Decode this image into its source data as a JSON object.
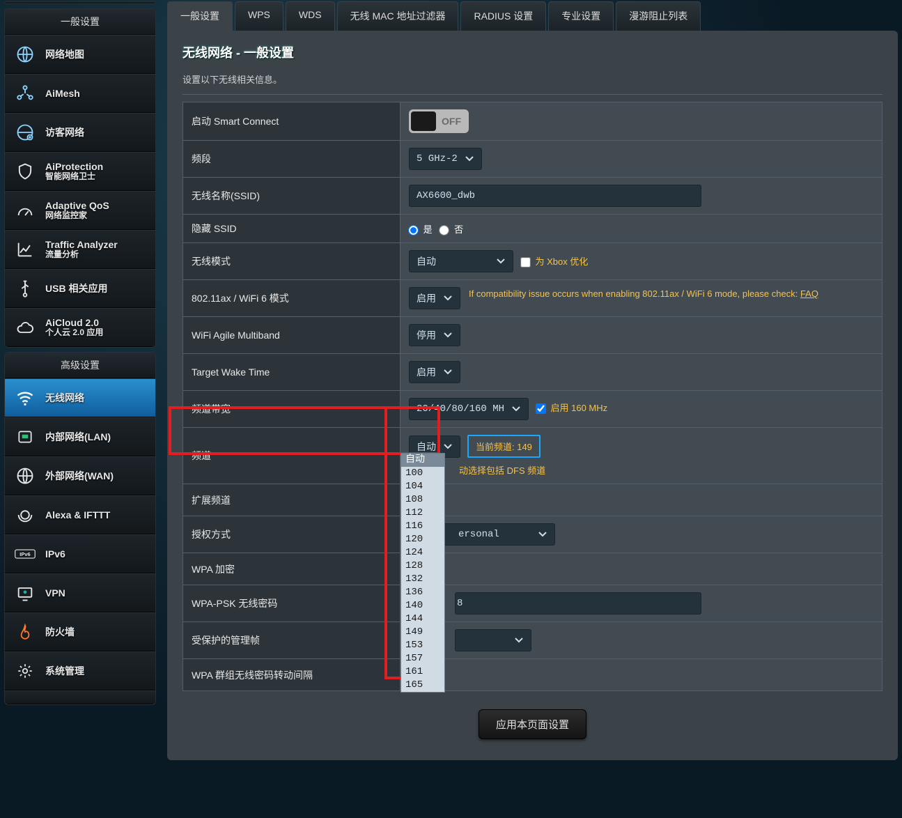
{
  "sidebar": {
    "section_general": "一般设置",
    "section_advanced": "高级设置",
    "general_items": [
      {
        "label": "网络地图"
      },
      {
        "label": "AiMesh"
      },
      {
        "label": "访客网络"
      },
      {
        "label": "AiProtection",
        "sub": "智能网络卫士"
      },
      {
        "label": "Adaptive QoS",
        "sub": "网络监控家"
      },
      {
        "label": "Traffic Analyzer",
        "sub": "流量分析"
      },
      {
        "label": "USB 相关应用"
      },
      {
        "label": "AiCloud 2.0",
        "sub": "个人云 2.0 应用"
      }
    ],
    "advanced_items": [
      {
        "label": "无线网络",
        "active": true
      },
      {
        "label": "内部网络(LAN)"
      },
      {
        "label": "外部网络(WAN)"
      },
      {
        "label": "Alexa & IFTTT"
      },
      {
        "label": "IPv6"
      },
      {
        "label": "VPN"
      },
      {
        "label": "防火墙"
      },
      {
        "label": "系统管理"
      }
    ]
  },
  "tabs": [
    "一般设置",
    "WPS",
    "WDS",
    "无线 MAC 地址过滤器",
    "RADIUS 设置",
    "专业设置",
    "漫游阻止列表"
  ],
  "active_tab": 0,
  "page": {
    "title": "无线网络 - 一般设置",
    "desc": "设置以下无线相关信息。"
  },
  "form": {
    "smart_connect": {
      "label": "启动 Smart Connect",
      "state": "OFF"
    },
    "band": {
      "label": "频段",
      "value": "5 GHz-2"
    },
    "ssid": {
      "label": "无线名称(SSID)",
      "value": "AX6600_dwb"
    },
    "hide_ssid": {
      "label": "隐藏 SSID",
      "yes": "是",
      "no": "否",
      "selected": "yes"
    },
    "mode": {
      "label": "无线模式",
      "value": "自动",
      "xbox_label": "为 Xbox 优化"
    },
    "ax": {
      "label": "802.11ax / WiFi 6 模式",
      "value": "启用",
      "note": "If compatibility issue occurs when enabling 802.11ax / WiFi 6 mode, please check: ",
      "faq": "FAQ"
    },
    "agile": {
      "label": "WiFi Agile Multiband",
      "value": "停用"
    },
    "twt": {
      "label": "Target Wake Time",
      "value": "启用"
    },
    "bw": {
      "label": "频道带宽",
      "value": "20/40/80/160 MH",
      "check_label": "启用 160 MHz"
    },
    "channel": {
      "label": "频道",
      "value": "自动",
      "current_label": "当前频道: 149",
      "dfs_prefix": "动选择包括 DFS 频道",
      "options": [
        "自动",
        "100",
        "104",
        "108",
        "112",
        "116",
        "120",
        "124",
        "128",
        "132",
        "136",
        "140",
        "144",
        "149",
        "153",
        "157",
        "161",
        "165"
      ]
    },
    "ext_channel": {
      "label": "扩展频道"
    },
    "auth": {
      "label": "授权方式",
      "value_suffix": "ersonal"
    },
    "wpa_enc": {
      "label": "WPA 加密"
    },
    "wpa_psk": {
      "label": "WPA-PSK 无线密码",
      "value_suffix": "8"
    },
    "pmf": {
      "label": "受保护的管理帧"
    },
    "group_key": {
      "label": "WPA 群组无线密码转动间隔"
    }
  },
  "apply_label": "应用本页面设置"
}
